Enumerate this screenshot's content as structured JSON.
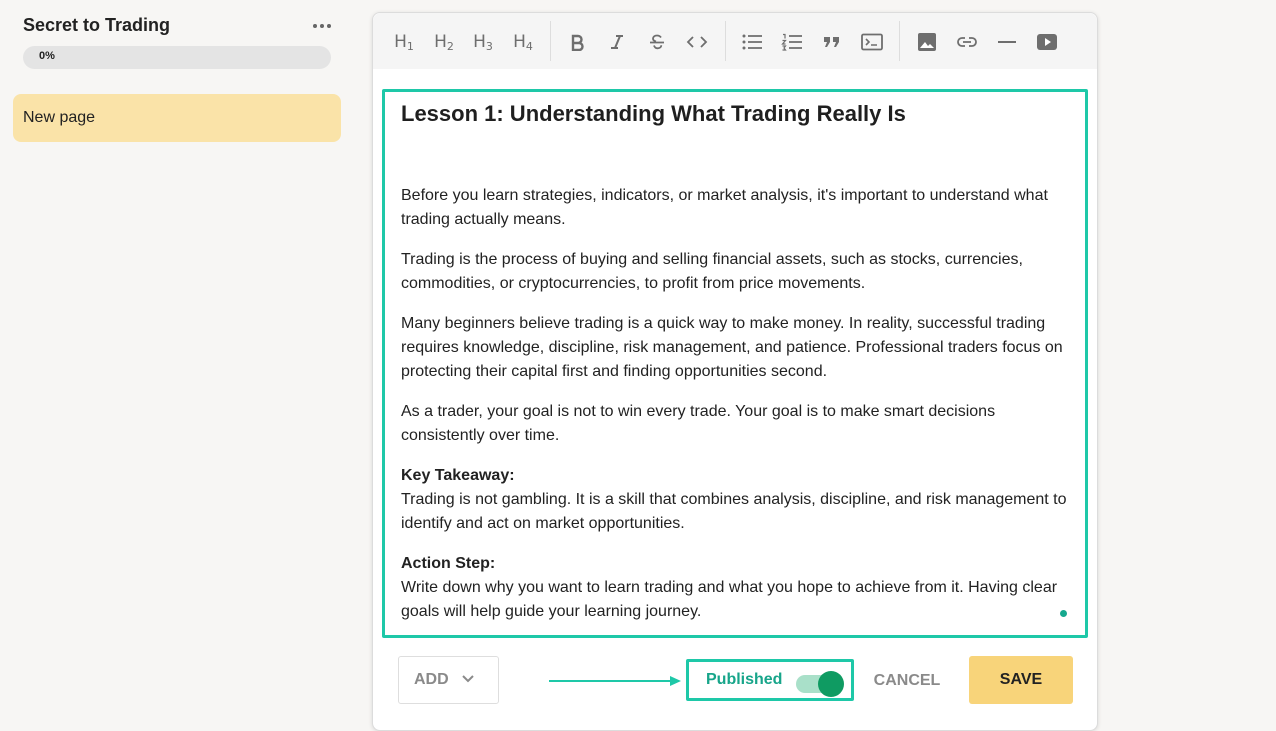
{
  "sidebar": {
    "course_title": "Secret to Trading",
    "progress_percent": 0,
    "progress_text": "0%",
    "pages": [
      {
        "label": "New page"
      }
    ]
  },
  "toolbar": {
    "buttons": [
      {
        "name": "heading-1",
        "icon": "h1-icon",
        "text": "H",
        "sub": "1"
      },
      {
        "name": "heading-2",
        "icon": "h2-icon",
        "text": "H",
        "sub": "2"
      },
      {
        "name": "heading-3",
        "icon": "h3-icon",
        "text": "H",
        "sub": "3"
      },
      {
        "name": "heading-4",
        "icon": "h4-icon",
        "text": "H",
        "sub": "4"
      },
      {
        "name": "bold",
        "icon": "bold-icon"
      },
      {
        "name": "italic",
        "icon": "italic-icon"
      },
      {
        "name": "strikethrough",
        "icon": "strikethrough-icon"
      },
      {
        "name": "code",
        "icon": "code-icon"
      },
      {
        "name": "bullet-list",
        "icon": "bullet-list-icon"
      },
      {
        "name": "ordered-list",
        "icon": "ordered-list-icon"
      },
      {
        "name": "quote",
        "icon": "quote-icon"
      },
      {
        "name": "code-block",
        "icon": "terminal-icon"
      },
      {
        "name": "image",
        "icon": "image-icon"
      },
      {
        "name": "link",
        "icon": "link-icon"
      },
      {
        "name": "divider",
        "icon": "horizontal-rule-icon"
      },
      {
        "name": "video",
        "icon": "video-icon"
      }
    ]
  },
  "content": {
    "title": "Lesson 1: Understanding What Trading Really Is",
    "paragraphs": [
      "Before you learn strategies, indicators, or market analysis, it's important to understand what trading actually means.",
      "Trading is the process of buying and selling financial assets, such as stocks, currencies, commodities, or cryptocurrencies, to profit from price movements.",
      "Many beginners believe trading is a quick way to make money. In reality, successful trading requires knowledge, discipline, risk management, and patience. Professional traders focus on protecting their capital first and finding opportunities second.",
      "As a trader, your goal is not to win every trade. Your goal is to make smart decisions consistently over time."
    ],
    "takeaway": {
      "heading": "Key Takeaway:",
      "text": "Trading is not gambling. It is a skill that combines analysis, discipline, and risk management to identify and act on market opportunities."
    },
    "action": {
      "heading": "Action Step:",
      "text": "Write down why you want to learn trading and what you hope to achieve from it. Having clear goals will help guide your learning journey."
    }
  },
  "footer": {
    "add_label": "ADD",
    "published_label": "Published",
    "published_on": true,
    "cancel_label": "CANCEL",
    "save_label": "SAVE"
  },
  "colors": {
    "accent_teal": "#1ec8a8",
    "toggle_on": "#0f9b62",
    "save_yellow": "#f8d47a",
    "page_highlight": "#fae3a8"
  }
}
